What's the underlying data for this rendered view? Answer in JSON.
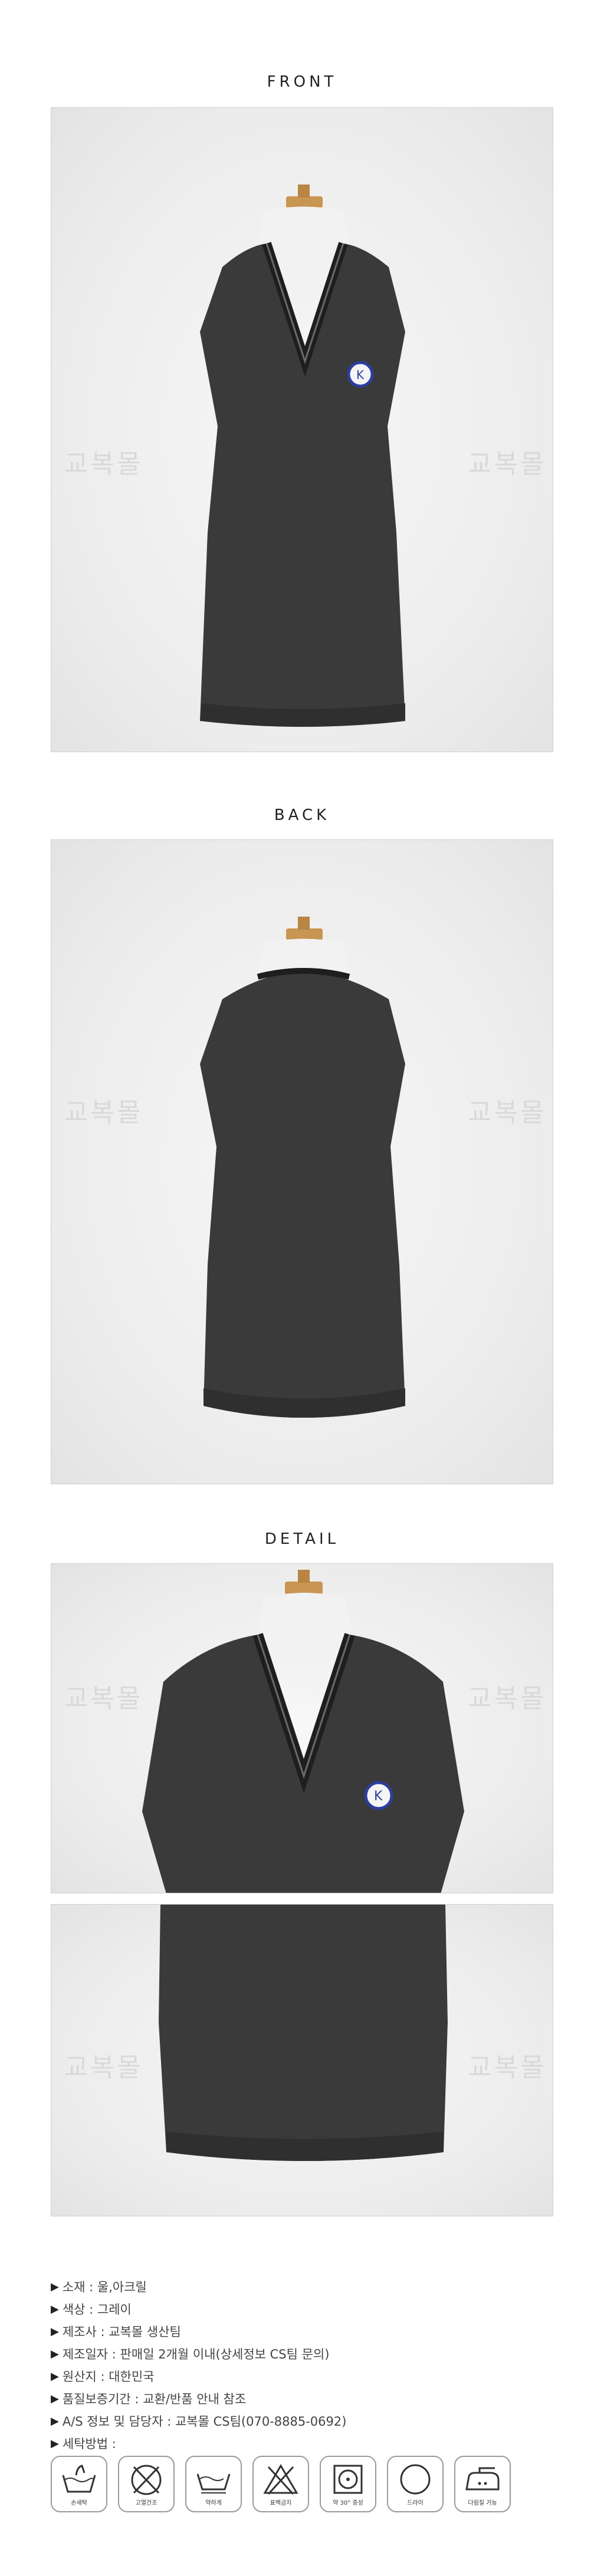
{
  "sections": {
    "front": "FRONT",
    "back": "BACK",
    "detail": "DETAIL"
  },
  "watermark": "교복몰",
  "specs": [
    "소재 : 울,아크릴",
    "색상 : 그레이",
    "제조사 : 교복몰 생산팀",
    "제조일자 : 판매일 2개월 이내(상세정보 CS팀 문의)",
    "원산지 : 대한민국",
    "품질보증기간 : 교환/반품 안내 참조",
    "A/S 정보 및 담당자 : 교복몰 CS팀(070-8885-0692)",
    "세탁방법 :"
  ],
  "spec_arrow": "▶",
  "care": [
    {
      "icon": "hand-wash-icon",
      "label": "손세탁"
    },
    {
      "icon": "tumble-dry-prohibited-icon",
      "label": "고열건조"
    },
    {
      "icon": "gentle-wash-icon",
      "label": "약하게"
    },
    {
      "icon": "no-bleach-icon",
      "label": "표백금지"
    },
    {
      "icon": "wash-30-icon",
      "label": "약 30° 중성"
    },
    {
      "icon": "dry-clean-icon",
      "label": "드라이"
    },
    {
      "icon": "iron-icon",
      "label": "다림질 가능"
    }
  ],
  "colors": {
    "vest": "#3b3b3b",
    "trim": "#1e1e1e",
    "mannequin": "#f4f4f4",
    "stand": "#c99552"
  }
}
